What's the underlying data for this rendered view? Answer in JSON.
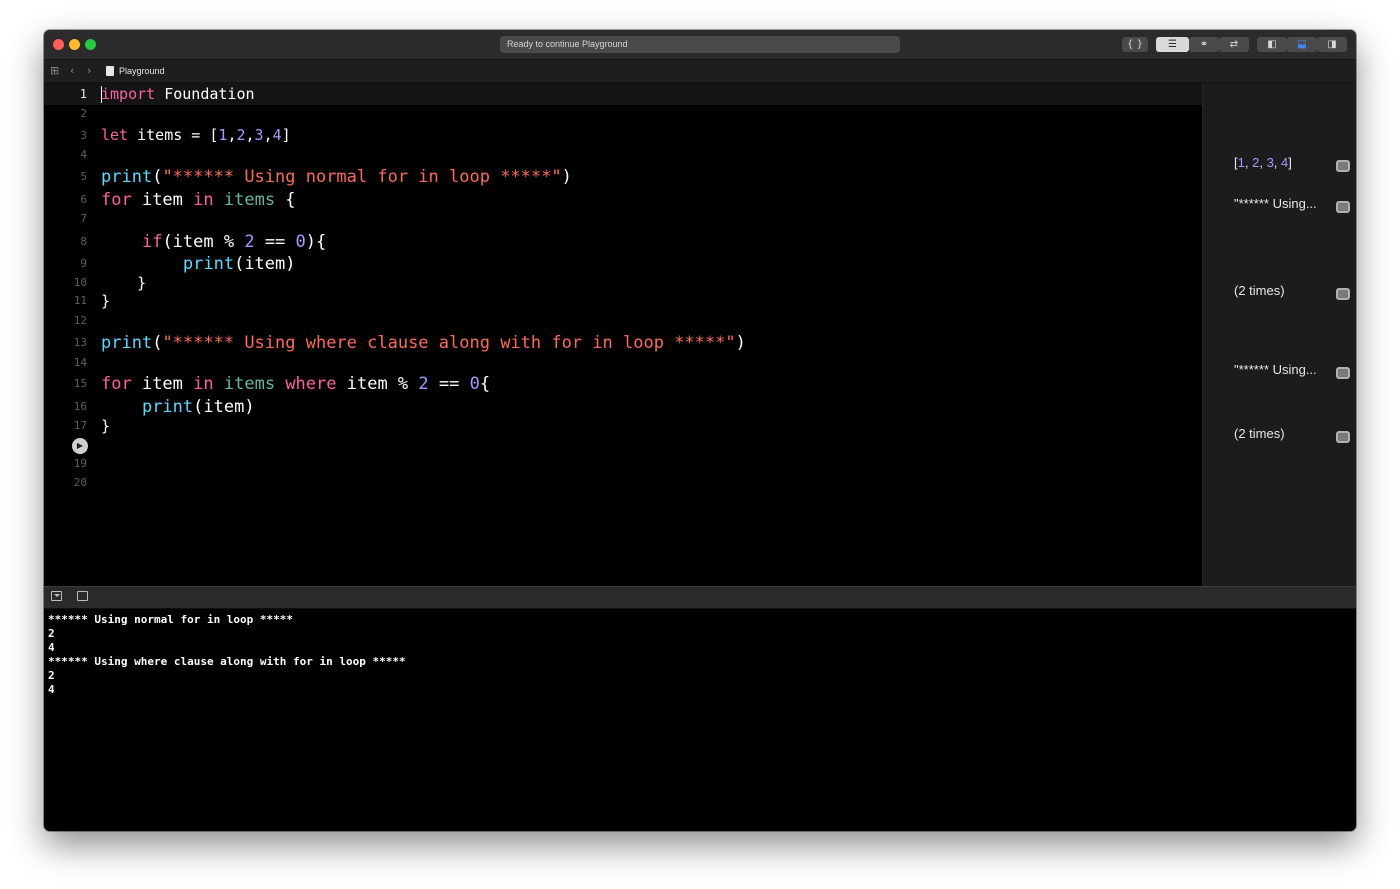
{
  "window": {
    "status_text": "Ready to continue Playground"
  },
  "toolbar": {
    "code_review_label": "{ }",
    "standard_editor_icon": "text-lines-icon",
    "assistant_icon": "venn-circles-icon",
    "version_icon": "arrows-swap-icon",
    "navigator_icon": "left-panel-icon",
    "debug_area_icon": "bottom-panel-icon",
    "inspector_icon": "right-panel-icon",
    "active_color": "#3d8bf7"
  },
  "navbar": {
    "file_name": "Playground"
  },
  "editor": {
    "line_numbers": [
      "1",
      "2",
      "3",
      "4",
      "5",
      "6",
      "7",
      "8",
      "9",
      "10",
      "11",
      "12",
      "13",
      "14",
      "15",
      "16",
      "17",
      "18",
      "19",
      "20"
    ],
    "current_line": "1",
    "run_line": "18",
    "lines": {
      "l1": {
        "kw": "import",
        "rest": " Foundation"
      },
      "l3": {
        "kw": "let",
        "p1": " items = [",
        "n1": "1",
        "c1": ",",
        "n2": "2",
        "c2": ",",
        "n3": "3",
        "c3": ",",
        "n4": "4",
        "end": "]"
      },
      "l5": {
        "fn": "print",
        "open": "(",
        "str": "\"****** Using normal for in loop *****\"",
        "close": ")"
      },
      "l6": {
        "kw1": "for",
        "p1": " item ",
        "kw2": "in",
        "sp": " ",
        "var": "items",
        "end": " {"
      },
      "l8": {
        "indent": "    ",
        "kw": "if",
        "p1": "(item % ",
        "n1": "2",
        "p2": " == ",
        "n2": "0",
        "end": "){"
      },
      "l9": {
        "indent": "        ",
        "fn": "print",
        "end": "(item)"
      },
      "l10": {
        "text": "    }"
      },
      "l11": {
        "text": "}"
      },
      "l13": {
        "fn": "print",
        "open": "(",
        "str": "\"****** Using where clause along with for in loop *****\"",
        "close": ")"
      },
      "l15": {
        "kw1": "for",
        "p1": " item ",
        "kw2": "in",
        "sp": " ",
        "var": "items",
        "sp2": " ",
        "kw3": "where",
        "p2": " item % ",
        "n1": "2",
        "p3": " == ",
        "n2": "0",
        "end": "{"
      },
      "l16": {
        "indent": "    ",
        "fn": "print",
        "end": "(item)"
      },
      "l17": {
        "text": "}"
      }
    }
  },
  "results": {
    "r1": {
      "p1": "[",
      "n1": "1",
      "c1": ", ",
      "n2": "2",
      "c2": ", ",
      "n3": "3",
      "c3": ", ",
      "n4": "4",
      "end": "]"
    },
    "r2": "\"****** Using...",
    "r3": "(2 times)",
    "r4": "\"****** Using...",
    "r5": "(2 times)"
  },
  "console": {
    "lines": [
      "****** Using normal for in loop *****",
      "2",
      "4",
      "****** Using where clause along with for in loop *****",
      "2",
      "4"
    ]
  },
  "colors": {
    "keyword": "#fc5fa3",
    "string": "#fc6a5d",
    "number": "#a39bff",
    "function": "#5dd8ff",
    "variable": "#67b7a4"
  }
}
